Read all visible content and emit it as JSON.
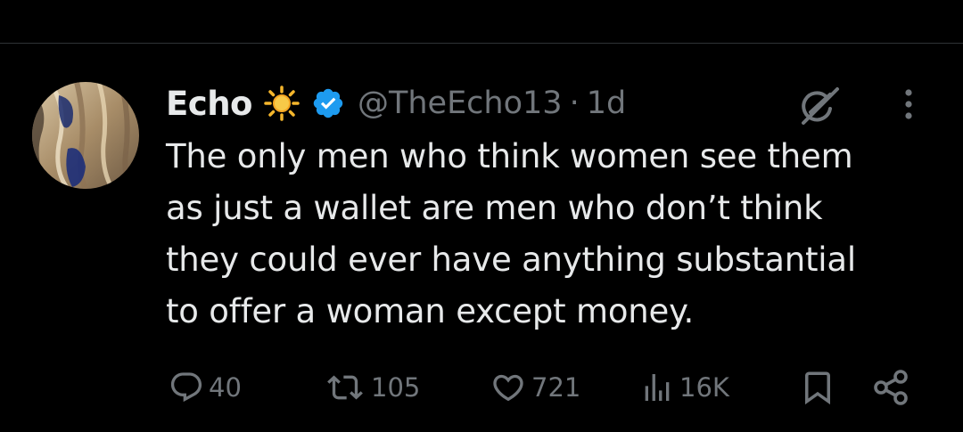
{
  "tweet": {
    "author": {
      "display_name": "Echo",
      "name_emoji": "sun-emoji",
      "verified_icon": "verified-badge-icon",
      "handle": "@TheEcho13",
      "separator": "·",
      "time_ago": "1d"
    },
    "text_lines": [
      "The only men who think women see them",
      "as just a wallet are men who don’t think",
      "they could ever have anything substantial",
      "to offer a woman except money."
    ],
    "header_icons": [
      "grok-icon",
      "more-options-icon"
    ],
    "actions": {
      "reply": {
        "icon": "reply-icon",
        "count": "40"
      },
      "repost": {
        "icon": "repost-icon",
        "count": "105"
      },
      "like": {
        "icon": "like-icon",
        "count": "721"
      },
      "views": {
        "icon": "views-icon",
        "count": "16K"
      },
      "bookmark": {
        "icon": "bookmark-icon"
      },
      "share": {
        "icon": "share-icon"
      }
    }
  },
  "colors": {
    "background": "#000000",
    "primary_text": "#e7e9ea",
    "secondary_text": "#71767b",
    "verified_blue": "#1d9bf0",
    "divider": "#2f3336"
  }
}
